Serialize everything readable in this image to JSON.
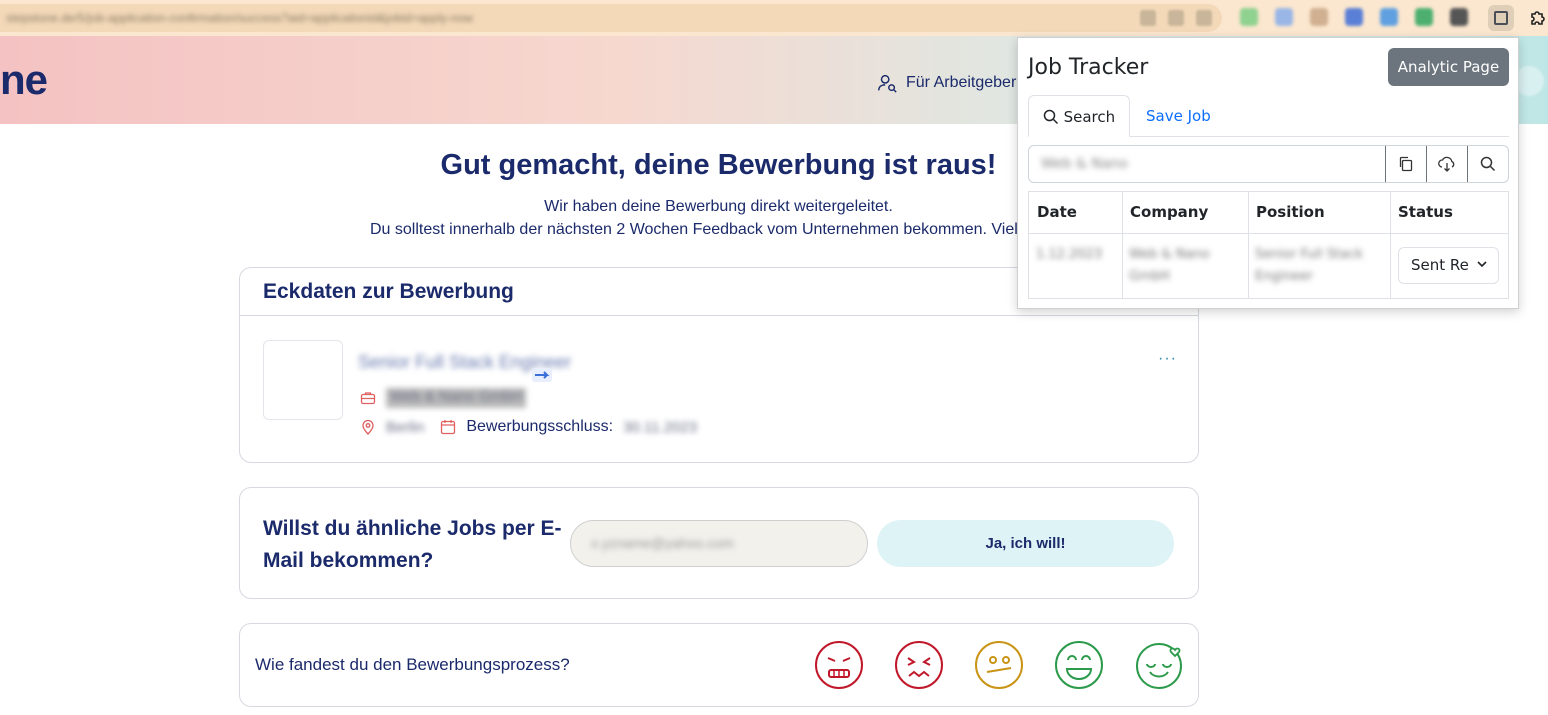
{
  "browser": {
    "url": "stepstone.de/5/job-application-confirmation/success?aid=applicationid&jobid=apply-now"
  },
  "header": {
    "logo_text": "ne",
    "employer_link": "Für Arbeitgeber"
  },
  "main": {
    "headline": "Gut gemacht, deine Bewerbung ist raus!",
    "subline1": "Wir haben deine Bewerbung direkt weitergeleitet.",
    "subline2": "Du solltest innerhalb der nächsten 2 Wochen Feedback vom Unternehmen bekommen. Viel"
  },
  "details": {
    "title": "Eckdaten zur Bewerbung",
    "job_title": "Senior Full Stack Engineer",
    "company": "Web & Nano GmbH",
    "location": "Berlin",
    "deadline_label": "Bewerbungsschluss:",
    "deadline_value": "30.11.2023",
    "more": "···"
  },
  "email": {
    "question": "Willst du ähnliche Jobs per E-Mail bekommen?",
    "input_value": "x.yzname@yahoo.com",
    "button": "Ja, ich will!"
  },
  "rating": {
    "question": "Wie fandest du den Bewerbungsprozess?",
    "options": [
      "very-angry-face-icon",
      "sad-face-icon",
      "neutral-face-icon",
      "happy-face-icon",
      "love-face-icon"
    ]
  },
  "popup": {
    "title": "Job Tracker",
    "analytic_button": "Analytic Page",
    "tabs": {
      "search": "Search",
      "save": "Save Job"
    },
    "search_value": "Web & Nano",
    "table": {
      "headers": [
        "Date",
        "Company",
        "Position",
        "Status"
      ],
      "rows": [
        {
          "date": "1.12.2023",
          "company": "Web & Nano GmbH",
          "position": "Senior Full Stack Engineer",
          "status": "Sent Re"
        }
      ]
    }
  }
}
